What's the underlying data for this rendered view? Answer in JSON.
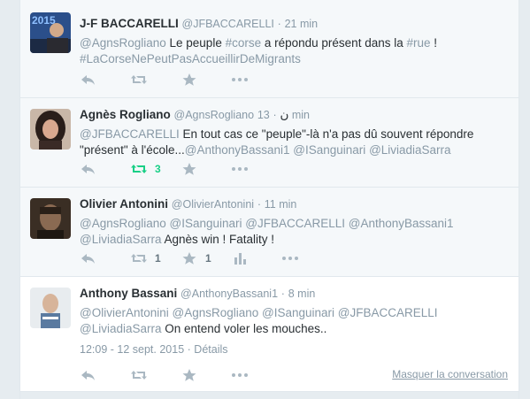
{
  "tweets": [
    {
      "fullname": "J-F BACCARELLI",
      "screen_name": "@JFBACCARELLI",
      "sep": "·",
      "time": "21 min",
      "text_parts": [
        "@AgnsRogliano",
        " Le peuple ",
        "#corse",
        " a  répondu présent dans la ",
        "#rue",
        " !"
      ],
      "text_line2": "#LaCorseNePeutPasAccueillirDeMigrants",
      "avatar_label": "2015"
    },
    {
      "fullname": "Agnès Rogliano",
      "screen_name": "@AgnsRogliano",
      "name_suffix": "ن",
      "sep": "·",
      "time": "13 min",
      "text_parts": [
        "@JFBACCARELLI",
        " En tout cas ce \"peuple\"-là n'a pas dû souvent répondre"
      ],
      "text_line2_parts": [
        "\"présent\" à l'école...",
        "@AnthonyBassani1",
        " ",
        "@ISanguinari",
        " ",
        "@LiviadiaSarra"
      ],
      "retweet_count": "3"
    },
    {
      "fullname": "Olivier Antonini",
      "screen_name": "@OlivierAntonini",
      "sep": "·",
      "time": "11 min",
      "text_line1": "@AgnsRogliano @ISanguinari @JFBACCARELLI @AnthonyBassani1",
      "text_line2_parts": [
        "@LiviadiaSarra",
        " Agnès win ! Fatality !"
      ],
      "retweet_count": "1",
      "favorite_count": "1"
    },
    {
      "fullname": "Anthony Bassani",
      "screen_name": "@AnthonyBassani1",
      "sep": "·",
      "time": "8 min",
      "text_line1": "@OlivierAntonini @AgnsRogliano @ISanguinari @JFBACCARELLI",
      "text_line2_parts": [
        "@LiviadiaSarra",
        " On entend voler les mouches.."
      ],
      "timestamp": "12:09 - 12 sept. 2015",
      "details": "Détails",
      "hide_conversation": "Masquer la conversation"
    }
  ],
  "icons": {
    "reply": "reply-icon",
    "retweet": "retweet-icon",
    "favorite": "star-icon",
    "more": "more-dots-icon",
    "analytics": "analytics-icon"
  },
  "colors": {
    "muted": "#8899a6",
    "retweet_active": "#19cf86",
    "action_icon": "#aab8c2"
  },
  "separator_dot": "·"
}
